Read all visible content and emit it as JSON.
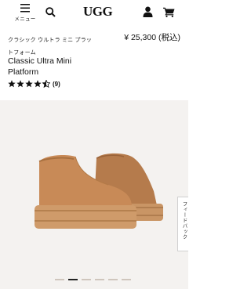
{
  "header": {
    "menu_label": "メニュー",
    "logo": "UGG"
  },
  "product": {
    "name_jp_line1": "クラシック ウルトラ ミニ プラッ",
    "name_jp_line2": "トフォーム",
    "price": "¥ 25,300 (税込)",
    "name_en_line1": "Classic Ultra Mini",
    "name_en_line2": "Platform",
    "rating": 4.5,
    "review_count": "(9)"
  },
  "gallery": {
    "feedback_label": "フィードバック",
    "image_count": 6,
    "active_index": 1
  },
  "colors": {
    "boot": "#c18a5a",
    "gallery_bg": "#f4f2f0"
  }
}
